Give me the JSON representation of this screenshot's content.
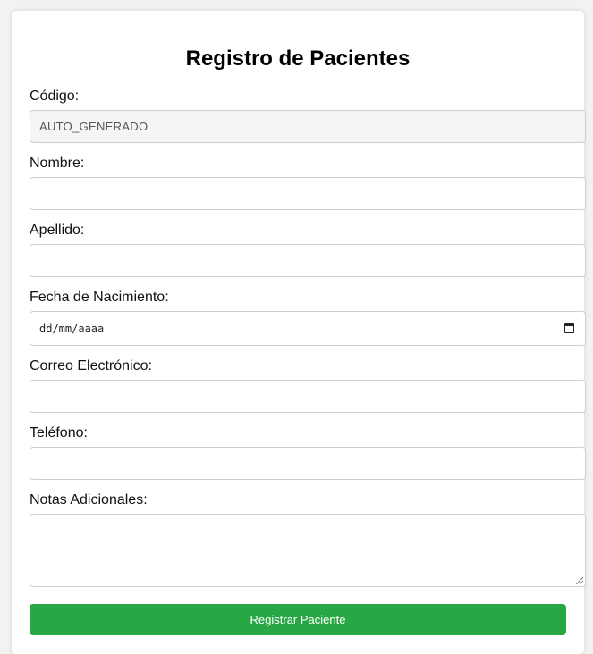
{
  "form": {
    "title": "Registro de Pacientes",
    "fields": {
      "codigo": {
        "label": "Código:",
        "value": "AUTO_GENERADO"
      },
      "nombre": {
        "label": "Nombre:",
        "value": ""
      },
      "apellido": {
        "label": "Apellido:",
        "value": ""
      },
      "fecha_nacimiento": {
        "label": "Fecha de Nacimiento:",
        "placeholder": "dd/mm/aaaa"
      },
      "correo": {
        "label": "Correo Electrónico:",
        "value": ""
      },
      "telefono": {
        "label": "Teléfono:",
        "value": ""
      },
      "notas": {
        "label": "Notas Adicionales:",
        "value": ""
      }
    },
    "submit_label": "Registrar Paciente"
  },
  "colors": {
    "submit_button": "#28a745",
    "page_background": "#f2f2f2",
    "readonly_field_background": "#f5f5f5"
  }
}
